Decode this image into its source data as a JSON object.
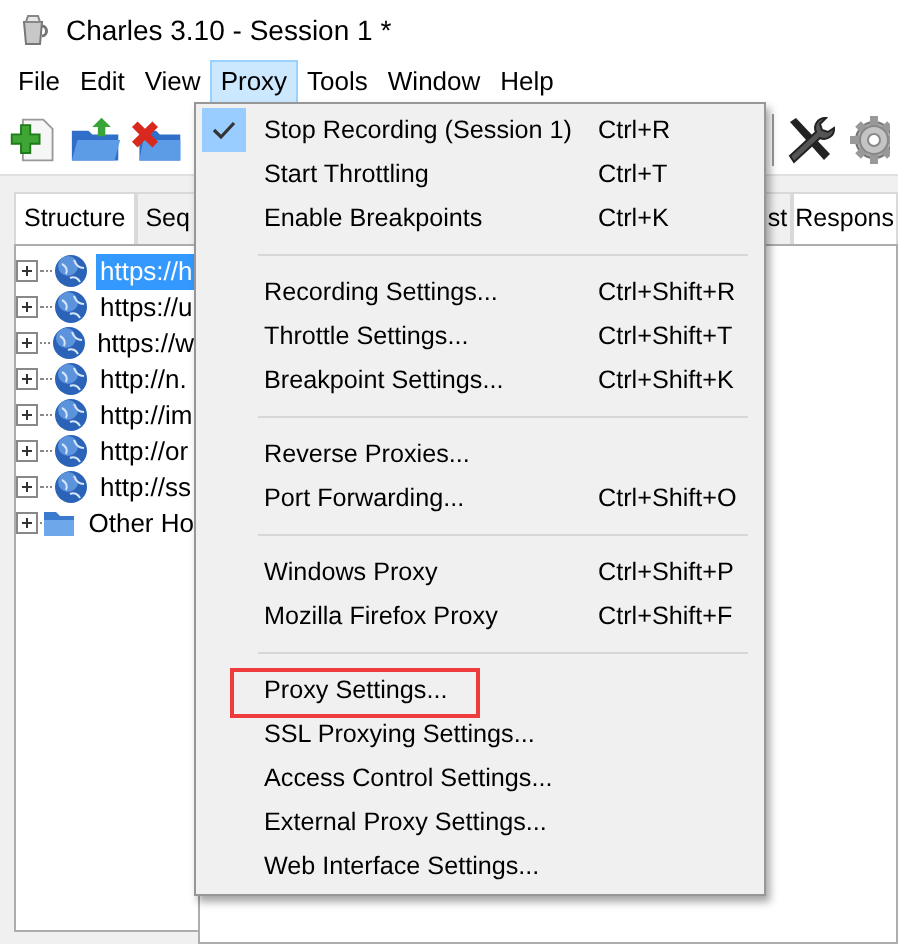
{
  "window": {
    "title": "Charles 3.10 - Session 1 *"
  },
  "menu_bar": [
    {
      "label": "File",
      "selected": false
    },
    {
      "label": "Edit",
      "selected": false
    },
    {
      "label": "View",
      "selected": false
    },
    {
      "label": "Proxy",
      "selected": true
    },
    {
      "label": "Tools",
      "selected": false
    },
    {
      "label": "Window",
      "selected": false
    },
    {
      "label": "Help",
      "selected": false
    }
  ],
  "left_tabs": [
    {
      "label": "Structure",
      "selected": true
    },
    {
      "label": "Seq",
      "selected": false
    }
  ],
  "right_tabs": [
    {
      "label": "st",
      "selected": false
    },
    {
      "label": "Respons",
      "selected": true
    }
  ],
  "tree": [
    {
      "label": "https://h",
      "kind": "host",
      "selected": true
    },
    {
      "label": "https://u",
      "kind": "host",
      "selected": false
    },
    {
      "label": "https://w",
      "kind": "host",
      "selected": false
    },
    {
      "label": "http://n.",
      "kind": "host",
      "selected": false
    },
    {
      "label": "http://im",
      "kind": "host",
      "selected": false
    },
    {
      "label": "http://or",
      "kind": "host",
      "selected": false
    },
    {
      "label": "http://ss",
      "kind": "host",
      "selected": false
    },
    {
      "label": "Other Ho",
      "kind": "folder",
      "selected": false
    }
  ],
  "proxy_menu": {
    "groups": [
      [
        {
          "label": "Stop Recording (Session 1)",
          "shortcut": "Ctrl+R",
          "checked": true,
          "annotated": false
        },
        {
          "label": "Start Throttling",
          "shortcut": "Ctrl+T",
          "checked": false,
          "annotated": false
        },
        {
          "label": "Enable Breakpoints",
          "shortcut": "Ctrl+K",
          "checked": false,
          "annotated": false
        }
      ],
      [
        {
          "label": "Recording Settings...",
          "shortcut": "Ctrl+Shift+R",
          "checked": false,
          "annotated": false
        },
        {
          "label": "Throttle Settings...",
          "shortcut": "Ctrl+Shift+T",
          "checked": false,
          "annotated": false
        },
        {
          "label": "Breakpoint Settings...",
          "shortcut": "Ctrl+Shift+K",
          "checked": false,
          "annotated": false
        }
      ],
      [
        {
          "label": "Reverse Proxies...",
          "checked": false,
          "annotated": false
        },
        {
          "label": "Port Forwarding...",
          "shortcut": "Ctrl+Shift+O",
          "checked": false,
          "annotated": false
        }
      ],
      [
        {
          "label": "Windows Proxy",
          "shortcut": "Ctrl+Shift+P",
          "checked": false,
          "annotated": false
        },
        {
          "label": "Mozilla Firefox Proxy",
          "shortcut": "Ctrl+Shift+F",
          "checked": false,
          "annotated": false
        }
      ],
      [
        {
          "label": "Proxy Settings...",
          "checked": false,
          "annotated": true
        },
        {
          "label": "SSL Proxying Settings...",
          "checked": false,
          "annotated": false
        },
        {
          "label": "Access Control Settings...",
          "checked": false,
          "annotated": false
        },
        {
          "label": "External Proxy Settings...",
          "checked": false,
          "annotated": false
        },
        {
          "label": "Web Interface Settings...",
          "checked": false,
          "annotated": false
        }
      ]
    ]
  }
}
